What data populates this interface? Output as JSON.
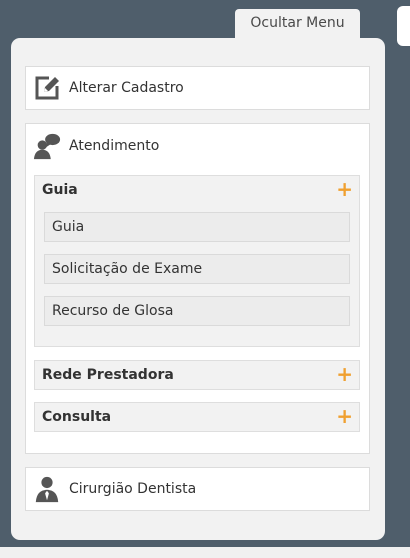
{
  "toggle": {
    "label": "Ocultar Menu"
  },
  "menu": {
    "alterar": {
      "label": "Alterar Cadastro",
      "icon": "edit-icon"
    },
    "atendimento": {
      "label": "Atendimento",
      "icon": "chat-user-icon",
      "groups": [
        {
          "label": "Guia",
          "toggle": "+",
          "items": [
            "Guia",
            "Solicitação de Exame",
            "Recurso de Glosa"
          ]
        },
        {
          "label": "Rede Prestadora",
          "toggle": "+"
        },
        {
          "label": "Consulta",
          "toggle": "+"
        }
      ]
    },
    "cirurgiao": {
      "label": "Cirurgião Dentista",
      "icon": "dentist-user-icon"
    }
  },
  "colors": {
    "background": "#4f5e6b",
    "panel": "#f2f2f2",
    "accent": "#f0a030",
    "icon": "#555555"
  }
}
